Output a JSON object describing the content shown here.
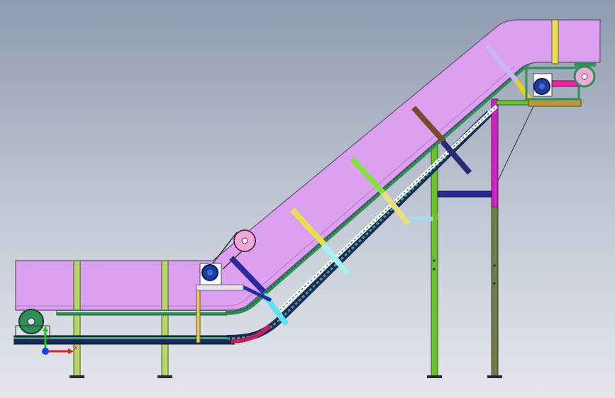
{
  "colors": {
    "housing": "#dca0f0",
    "housing_edge": "#6a4a7a",
    "chain_green": "#2f8f5a",
    "chain_dark": "#1e5a34",
    "leg_lime": "#b9d66b",
    "leg_green": "#6bbf2a",
    "leg_darkgreen": "#2f6b2f",
    "leg_magenta": "#d020c0",
    "leg_olive": "#6f7a4a",
    "brace_yellow": "#e4e050",
    "brace_cyan": "#a8f0f0",
    "brace_green": "#88e040",
    "brace_khaki": "#e8e080",
    "brace_brown": "#7a4a2a",
    "brace_navy": "#2a2a7a",
    "brace_lavender": "#c8b8f0",
    "motor_blue": "#1e3ea0",
    "sprocket_pink": "#f0a8d8",
    "base_navy": "#1a2a5a",
    "red_segment": "#c02060",
    "gold_plate": "#b89a40",
    "triad_x": "#e02020",
    "triad_y": "#20c020",
    "triad_z": "#2040e0"
  },
  "icons": [
    "coordinate-triad-icon",
    "drive-sprocket-icon",
    "motor-icon"
  ],
  "triad": {
    "x_label": "X"
  }
}
